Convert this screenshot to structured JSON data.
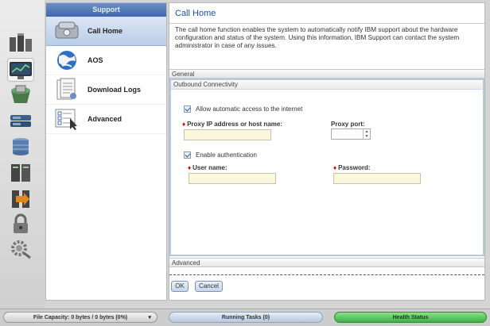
{
  "left_dock": {
    "icons": [
      {
        "name": "home-monitoring-icon"
      },
      {
        "name": "performance-monitor-icon"
      },
      {
        "name": "pools-icon"
      },
      {
        "name": "volumes-icon"
      },
      {
        "name": "hosts-database-icon"
      },
      {
        "name": "copy-services-icon"
      },
      {
        "name": "access-icon"
      },
      {
        "name": "security-lock-icon"
      },
      {
        "name": "settings-gear-icon"
      }
    ]
  },
  "side_panel": {
    "header": "Support",
    "items": [
      {
        "label": "Call Home",
        "icon": "call-home-icon"
      },
      {
        "label": "AOS",
        "icon": "globe-icon"
      },
      {
        "label": "Download Logs",
        "icon": "logs-document-icon"
      },
      {
        "label": "Advanced",
        "icon": "advanced-checklist-icon"
      }
    ]
  },
  "main": {
    "title": "Call Home",
    "description": "The call home function enables the system to automatically notify IBM support about the hardware configuration and status of the system. Using this information, IBM Support can contact the system administrator in case of any issues.",
    "general_label": "General",
    "connectivity": {
      "title": "Outbound Connectivity",
      "allow_internet_label": "Allow automatic access to the internet",
      "allow_internet_checked": true,
      "proxy_address_label": "Proxy IP address or host name:",
      "proxy_address_value": "",
      "proxy_port_label": "Proxy port:",
      "proxy_port_value": "",
      "enable_auth_label": "Enable authentication",
      "enable_auth_checked": true,
      "username_label": "User name:",
      "username_value": "",
      "password_label": "Password:",
      "password_value": ""
    },
    "advanced_label": "Advanced",
    "ok_label": "OK",
    "cancel_label": "Cancel"
  },
  "status_bar": {
    "capacity": "File Capacity: 0 bytes / 0 bytes (0%)",
    "running_tasks": "Running Tasks (0)",
    "health": "Health Status"
  },
  "colors": {
    "accent": "#1e4f9c",
    "header_blue": "#4a72b0",
    "health_green": "#3fb046",
    "input_yellow": "#fbf7dc"
  }
}
